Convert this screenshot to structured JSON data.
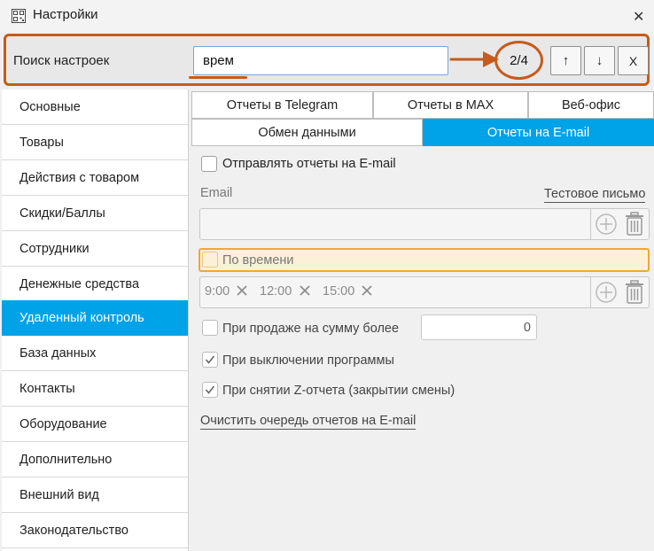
{
  "window": {
    "title": "Настройки"
  },
  "search": {
    "label": "Поиск настроек",
    "value": "врем",
    "counter": "2/4",
    "up_label": "↑",
    "down_label": "↓",
    "clear_label": "X"
  },
  "sidebar": {
    "items": [
      {
        "label": "Основные"
      },
      {
        "label": "Товары"
      },
      {
        "label": "Действия с товаром"
      },
      {
        "label": "Скидки/Баллы"
      },
      {
        "label": "Сотрудники"
      },
      {
        "label": "Денежные средства"
      },
      {
        "label": "Удаленный контроль",
        "active": true
      },
      {
        "label": "База данных"
      },
      {
        "label": "Контакты"
      },
      {
        "label": "Оборудование"
      },
      {
        "label": "Дополнительно"
      },
      {
        "label": "Внешний вид"
      },
      {
        "label": "Законодательство"
      }
    ]
  },
  "tabs": {
    "row1": [
      "Отчеты в Telegram",
      "Отчеты в MAX",
      "Веб-офис"
    ],
    "row2": [
      "Обмен данными",
      "Отчеты на E-mail"
    ],
    "active": "Отчеты на E-mail"
  },
  "email_panel": {
    "send_reports_label": "Отправлять отчеты на E-mail",
    "email_label": "Email",
    "test_letter_link": "Тестовое письмо",
    "by_time_label": "По времени",
    "times": [
      "9:00",
      "12:00",
      "15:00"
    ],
    "on_sale_label": "При продаже на сумму более",
    "on_sale_value": "0",
    "on_shutdown_label": "При выключении программы",
    "on_zreport_label": "При снятии Z-отчета (закрытии смены)",
    "clear_queue_link": "Очистить очередь отчетов на E-mail"
  },
  "colors": {
    "accent": "#00a2e8",
    "highlight_orange": "#c65b1b",
    "search_match_bg": "#fdf0d8",
    "search_match_border": "#f0a830"
  },
  "icons": [
    "app-icon",
    "close-icon",
    "arrow-right-annotation-icon",
    "add-circle-icon",
    "trash-icon",
    "remove-x-icon",
    "checkmark-icon"
  ]
}
